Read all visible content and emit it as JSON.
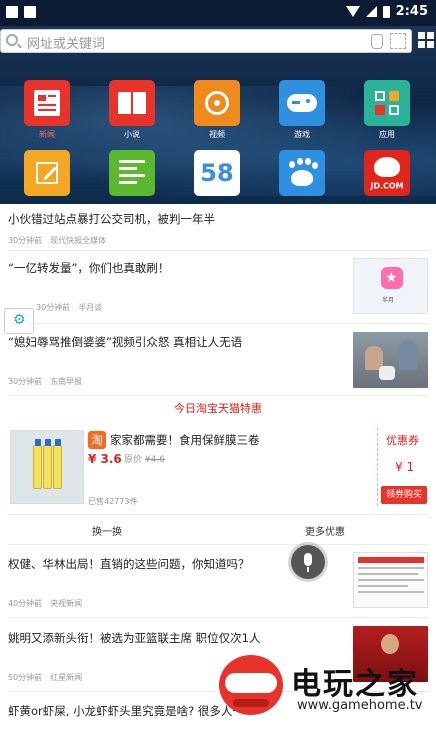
{
  "status": {
    "time": "2:45"
  },
  "search": {
    "placeholder": "网址或关键词"
  },
  "apps": [
    {
      "label": "新闻",
      "icon": "news-icon",
      "color": "#e8332a"
    },
    {
      "label": "小说",
      "icon": "book-icon",
      "color": "#e8332a"
    },
    {
      "label": "视频",
      "icon": "film-icon",
      "color": "#f08a1c"
    },
    {
      "label": "游戏",
      "icon": "gamepad-icon",
      "color": "#2f8fe0"
    },
    {
      "label": "应用",
      "icon": "apps-icon",
      "color": "#2bb39a"
    },
    {
      "label": "",
      "icon": "note-icon",
      "color": "#f5a623"
    },
    {
      "label": "",
      "icon": "text-icon",
      "color": "#5cb82e"
    },
    {
      "label": "",
      "icon": "58-icon",
      "glyph": "58",
      "color": "#ffffff"
    },
    {
      "label": "",
      "icon": "baidu-icon",
      "color": "#2f8fe0"
    },
    {
      "label": "JD.COM",
      "icon": "jd-icon",
      "color": "#e1251b"
    }
  ],
  "feed": [
    {
      "title": "小伙错过站点暴打公交司机，被判一年半",
      "time": "30分钟前",
      "source": "现代快报全媒体"
    },
    {
      "title": "“一亿转发量”，你们也真敢刷！",
      "time": "30分钟前",
      "source": "半月谈",
      "thumb_label": "半月"
    },
    {
      "title": "“媳妇辱骂推倒婆婆”视频引众怒 真相让人无语",
      "time": "30分钟前",
      "source": "东南早报"
    }
  ],
  "promo": {
    "header": "今日淘宝天猫特惠",
    "shop_logo": "淘",
    "title": "家家都需要！食用保鲜膜三卷",
    "price": "¥ 3.6",
    "orig_label": "原价",
    "orig_price": "¥4.6",
    "sold": "已售42773件",
    "coupon_label": "优惠券",
    "coupon_value": "¥ 1",
    "coupon_button": "领券购买",
    "refresh": "换一换",
    "more": "更多优惠"
  },
  "feed2": [
    {
      "title": "权健、华林出局！直销的这些问题，你知道吗？",
      "time": "40分钟前",
      "source": "央视新闻"
    },
    {
      "title": "姚明又添新头衔！被选为亚篮联主席 职位仅次1人",
      "time": "50分钟前",
      "source": "红星新闻"
    },
    {
      "title": "虾黄or虾屎, 小龙虾虾头里究竟是啥? 很多人一"
    }
  ],
  "watermark": {
    "text": "电玩之家",
    "url": "www.gamehome.tv"
  }
}
